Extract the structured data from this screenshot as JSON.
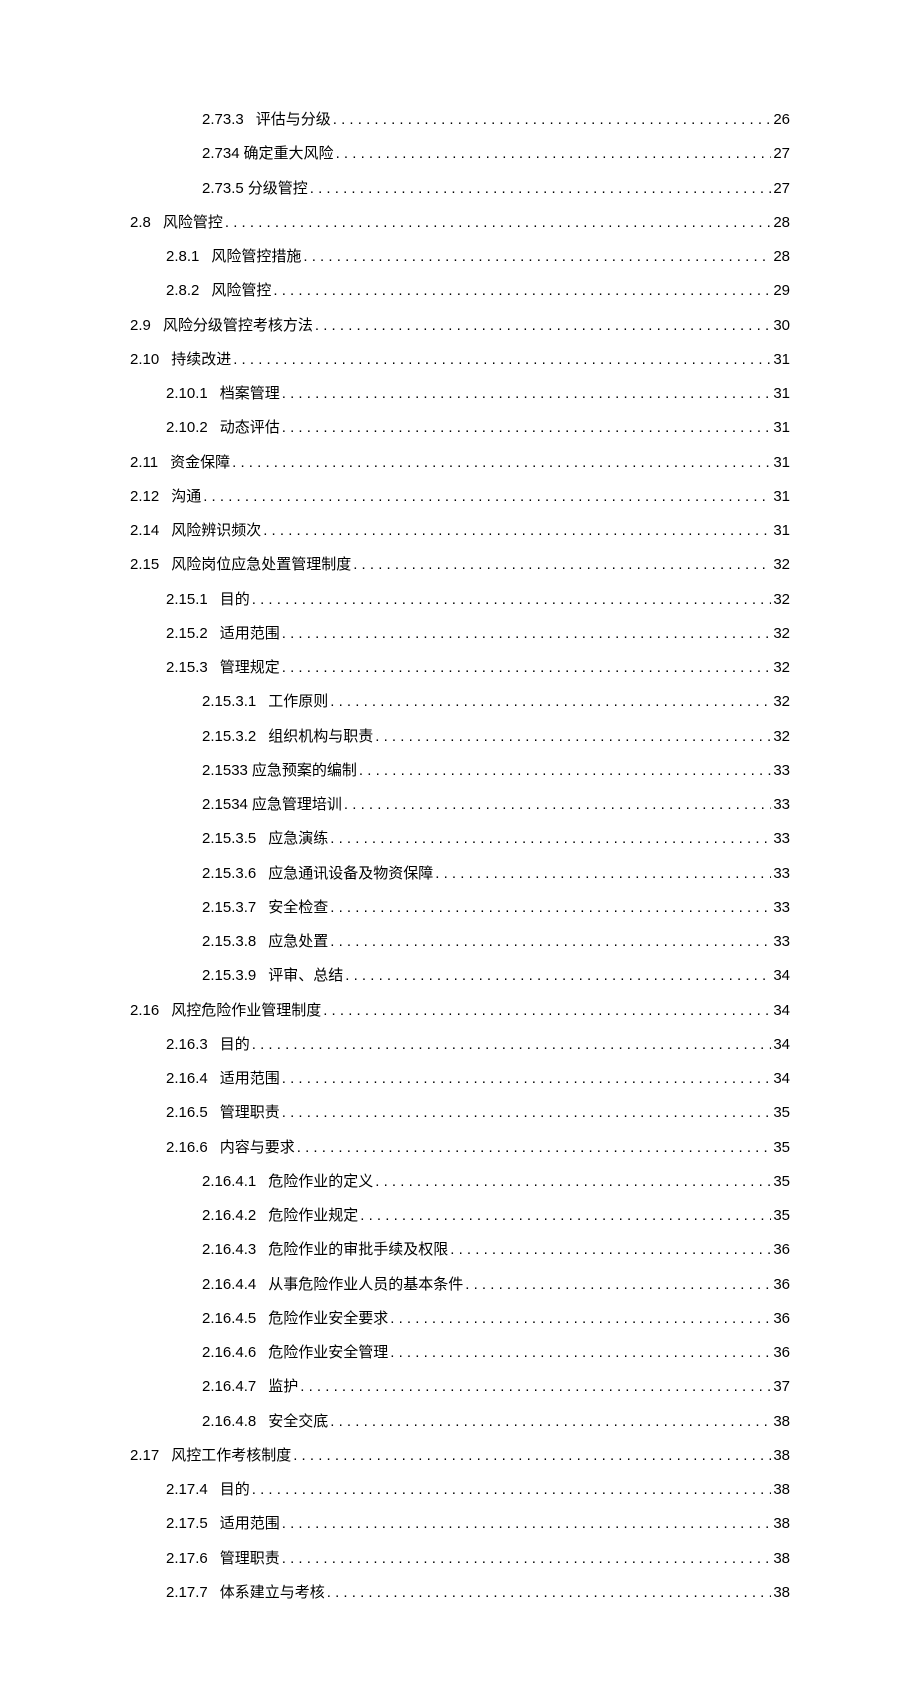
{
  "toc": [
    {
      "level": 3,
      "num": "2.73.3",
      "title": "评估与分级",
      "page": "26"
    },
    {
      "level": 3,
      "num": "2.734",
      "title": "确定重大风险",
      "page": "27",
      "tight": true
    },
    {
      "level": 3,
      "num": "2.73.5",
      "title": "分级管控",
      "page": "27",
      "tight": true
    },
    {
      "level": 1,
      "num": "2.8",
      "title": "风险管控",
      "page": "28"
    },
    {
      "level": 2,
      "num": "2.8.1",
      "title": "风险管控措施",
      "page": "28"
    },
    {
      "level": 2,
      "num": "2.8.2",
      "title": "风险管控",
      "page": "29"
    },
    {
      "level": 1,
      "num": "2.9",
      "title": "风险分级管控考核方法",
      "page": "30"
    },
    {
      "level": 1,
      "num": "2.10",
      "title": "持续改进",
      "page": "31"
    },
    {
      "level": 2,
      "num": "2.10.1",
      "title": "档案管理",
      "page": "31"
    },
    {
      "level": 2,
      "num": "2.10.2",
      "title": "动态评估",
      "page": "31"
    },
    {
      "level": 1,
      "num": "2.11",
      "title": "资金保障",
      "page": "31"
    },
    {
      "level": 1,
      "num": "2.12",
      "title": "沟通",
      "page": "31"
    },
    {
      "level": 1,
      "num": "2.14",
      "title": "风险辨识频次",
      "page": "31"
    },
    {
      "level": 1,
      "num": "2.15",
      "title": "风险岗位应急处置管理制度",
      "page": "32"
    },
    {
      "level": 2,
      "num": "2.15.1",
      "title": "目的",
      "page": "32"
    },
    {
      "level": 2,
      "num": "2.15.2",
      "title": "适用范围",
      "page": "32"
    },
    {
      "level": 2,
      "num": "2.15.3",
      "title": "管理规定",
      "page": "32"
    },
    {
      "level": 3,
      "num": "2.15.3.1",
      "title": "工作原则",
      "page": "32"
    },
    {
      "level": 3,
      "num": "2.15.3.2",
      "title": "组织机构与职责",
      "page": "32"
    },
    {
      "level": 3,
      "num": "2.1533",
      "title": "应急预案的编制",
      "page": "33",
      "tight": true
    },
    {
      "level": 3,
      "num": "2.1534",
      "title": "应急管理培训",
      "page": "33",
      "tight": true
    },
    {
      "level": 3,
      "num": "2.15.3.5",
      "title": "应急演练",
      "page": "33"
    },
    {
      "level": 3,
      "num": "2.15.3.6",
      "title": "应急通讯设备及物资保障",
      "page": "33"
    },
    {
      "level": 3,
      "num": "2.15.3.7",
      "title": "安全检查",
      "page": "33"
    },
    {
      "level": 3,
      "num": "2.15.3.8",
      "title": "应急处置",
      "page": "33"
    },
    {
      "level": 3,
      "num": "2.15.3.9",
      "title": "评审、总结",
      "page": "34"
    },
    {
      "level": 1,
      "num": "2.16",
      "title": "风控危险作业管理制度",
      "page": "34"
    },
    {
      "level": 2,
      "num": "2.16.3",
      "title": "目的",
      "page": "34"
    },
    {
      "level": 2,
      "num": "2.16.4",
      "title": "适用范围",
      "page": "34"
    },
    {
      "level": 2,
      "num": "2.16.5",
      "title": "管理职责",
      "page": "35"
    },
    {
      "level": 2,
      "num": "2.16.6",
      "title": "内容与要求",
      "page": "35"
    },
    {
      "level": 3,
      "num": "2.16.4.1",
      "title": "危险作业的定义",
      "page": "35"
    },
    {
      "level": 3,
      "num": "2.16.4.2",
      "title": "危险作业规定",
      "page": "35"
    },
    {
      "level": 3,
      "num": "2.16.4.3",
      "title": "危险作业的审批手续及权限",
      "page": "36"
    },
    {
      "level": 3,
      "num": "2.16.4.4",
      "title": "从事危险作业人员的基本条件",
      "page": "36"
    },
    {
      "level": 3,
      "num": "2.16.4.5",
      "title": "危险作业安全要求",
      "page": "36"
    },
    {
      "level": 3,
      "num": "2.16.4.6",
      "title": "危险作业安全管理",
      "page": "36"
    },
    {
      "level": 3,
      "num": "2.16.4.7",
      "title": "监护",
      "page": "37"
    },
    {
      "level": 3,
      "num": "2.16.4.8",
      "title": "安全交底",
      "page": "38"
    },
    {
      "level": 1,
      "num": "2.17",
      "title": "风控工作考核制度",
      "page": "38"
    },
    {
      "level": 2,
      "num": "2.17.4",
      "title": "目的",
      "page": "38"
    },
    {
      "level": 2,
      "num": "2.17.5",
      "title": "适用范围",
      "page": "38"
    },
    {
      "level": 2,
      "num": "2.17.6",
      "title": "管理职责",
      "page": "38"
    },
    {
      "level": 2,
      "num": "2.17.7",
      "title": "体系建立与考核",
      "page": "38"
    }
  ]
}
